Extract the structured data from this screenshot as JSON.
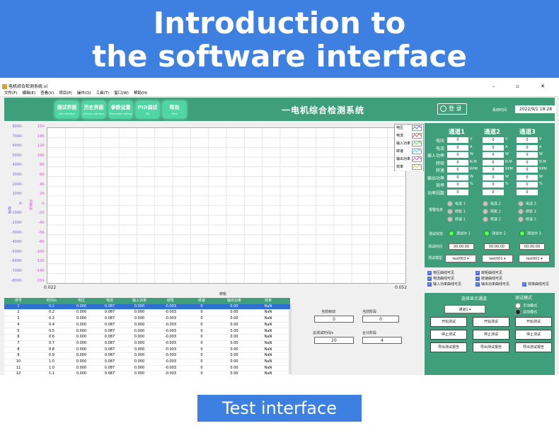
{
  "banner": {
    "line1": "Introduction to",
    "line2": "the software interface"
  },
  "window": {
    "title": "电机综合检测系统.vi",
    "buttons": "–  ▫  ✕"
  },
  "menu": [
    "文件(F)",
    "编辑(E)",
    "查看(V)",
    "项目(P)",
    "操作(O)",
    "工具(T)",
    "窗口(W)",
    "帮助(H)"
  ],
  "nav": [
    {
      "label": "测试界面",
      "sub": "Test interface"
    },
    {
      "label": "历史界面",
      "sub": "History interface"
    },
    {
      "label": "参数设置",
      "sub": "Parameter setting"
    },
    {
      "label": "PID调试",
      "sub": "PID"
    },
    {
      "label": "帮助",
      "sub": "Help"
    }
  ],
  "app_title": "一电机综合检测系统",
  "login": "登 录",
  "systime_label": "系统时间",
  "systime": "2022/9/1 18:28",
  "chart": {
    "y1_label": "转速",
    "y2_label": "功率电",
    "x_label": "转矩",
    "x_min": "0.022",
    "x_max": "0.052",
    "y1_ticks": [
      "8000-",
      "7000-",
      "6000-",
      "5000-",
      "4000-",
      "3000-",
      "2000-",
      "1000-",
      "0-",
      "-1000-",
      "-2000-",
      "-3000-",
      "-4000-",
      "-5000-",
      "-6000-",
      "-7000-",
      "-8000-"
    ],
    "y2_ticks": [
      "150-",
      "140-",
      "120-",
      "100-",
      "80-",
      "60-",
      "40-",
      "20-",
      "0-",
      "-20-",
      "-40-",
      "-60-",
      "-80-",
      "-100-",
      "-120-",
      "-140-",
      "-150-"
    ]
  },
  "legend": [
    {
      "name": "电压",
      "color": "#3a5fd8"
    },
    {
      "name": "电流",
      "color": "#d83a3a"
    },
    {
      "name": "输入功率",
      "color": "#3ad85a"
    },
    {
      "name": "转速",
      "color": "#3ab8d8"
    },
    {
      "name": "输出功率",
      "color": "#d83ad8"
    },
    {
      "name": "效率",
      "color": "#d8b83a"
    }
  ],
  "channels": [
    "通道1",
    "通道2",
    "通道3"
  ],
  "params": [
    {
      "label": "电压",
      "value": "0",
      "unit": "V"
    },
    {
      "label": "电流",
      "value": "0",
      "unit": "A"
    },
    {
      "label": "输入功率",
      "value": "0",
      "unit": "W"
    },
    {
      "label": "转矩",
      "value": "0",
      "unit": "N.M"
    },
    {
      "label": "转速",
      "value": "0",
      "unit": "RPM"
    },
    {
      "label": "输出功率",
      "value": "0",
      "unit": "W"
    },
    {
      "label": "效率",
      "value": "0",
      "unit": "%"
    },
    {
      "label": "功率因数",
      "value": "0",
      "unit": ""
    }
  ],
  "alarm_label": "报警信息",
  "alarms": [
    [
      "电流 1",
      "转矩 1",
      "转速 1"
    ],
    [
      "电流 2",
      "转矩 2",
      "转速 2"
    ],
    [
      "电流 3",
      "转矩 3",
      "转速 3"
    ]
  ],
  "test_state_label": "测试状态",
  "test_states": [
    "测试中 1",
    "测试中 2",
    "测试中 3"
  ],
  "test_time_label": "测试时间",
  "test_times": [
    "00:00:00",
    "00:00:00",
    "00:00:00"
  ],
  "test_model_label": "测试模型",
  "test_models": [
    "test003",
    "test001",
    "test001"
  ],
  "checks": [
    "电压曲线可见",
    "转矩曲线可见",
    "电流曲线可见",
    "转速曲线可见",
    "输入功率曲线可见",
    "输出功率曲线可见",
    "效率曲线可见"
  ],
  "select_channel_label": "选择显示通道",
  "selected_channel": "通道1",
  "test_mode_label": "测试模式",
  "test_modes": [
    "手动模式",
    "自动模式"
  ],
  "action_buttons": [
    "开始测试",
    "停止测试",
    "导出测试报告"
  ],
  "table": {
    "headers": [
      "序号",
      "时间/s",
      "电压",
      "电流",
      "输入功率",
      "转矩",
      "转速",
      "输出功率",
      "效率"
    ],
    "rows": [
      [
        "1",
        "0.1",
        "0.000",
        "0.087",
        "0.000",
        "-0.003",
        "0",
        "0.00",
        "NaN"
      ],
      [
        "2",
        "0.2",
        "0.000",
        "0.087",
        "0.000",
        "-0.003",
        "0",
        "0.00",
        "NaN"
      ],
      [
        "3",
        "0.3",
        "0.000",
        "0.087",
        "0.000",
        "-0.003",
        "0",
        "0.00",
        "NaN"
      ],
      [
        "4",
        "0.4",
        "0.000",
        "0.087",
        "0.000",
        "-0.003",
        "0",
        "0.00",
        "NaN"
      ],
      [
        "5",
        "0.5",
        "0.000",
        "0.087",
        "0.000",
        "-0.003",
        "0",
        "0.00",
        "NaN"
      ],
      [
        "6",
        "0.6",
        "0.000",
        "0.087",
        "0.000",
        "-0.003",
        "0",
        "0.00",
        "NaN"
      ],
      [
        "7",
        "0.7",
        "0.000",
        "0.087",
        "0.000",
        "-0.003",
        "0",
        "0.00",
        "NaN"
      ],
      [
        "8",
        "0.8",
        "0.000",
        "0.087",
        "0.000",
        "-0.003",
        "0",
        "0.00",
        "NaN"
      ],
      [
        "9",
        "0.9",
        "0.000",
        "0.087",
        "0.000",
        "-0.003",
        "0",
        "0.00",
        "NaN"
      ],
      [
        "10",
        "1.0",
        "0.000",
        "0.087",
        "0.000",
        "-0.003",
        "0",
        "0.00",
        "NaN"
      ],
      [
        "11",
        "1.0",
        "0.000",
        "0.087",
        "0.000",
        "-0.003",
        "0",
        "0.00",
        "NaN"
      ],
      [
        "12",
        "1.1",
        "0.000",
        "0.087",
        "0.000",
        "-0.003",
        "0",
        "0.00",
        "NaN"
      ]
    ]
  },
  "form": {
    "current_load_label": "当前帧动",
    "current_load": "0",
    "current_stage_label": "当前阶段",
    "current_stage": "0",
    "total_time_label": "总测试时间/s",
    "total_time": "20",
    "total_stage_label": "合计阶段",
    "total_stage": "4"
  },
  "bottom_label": "Test interface"
}
